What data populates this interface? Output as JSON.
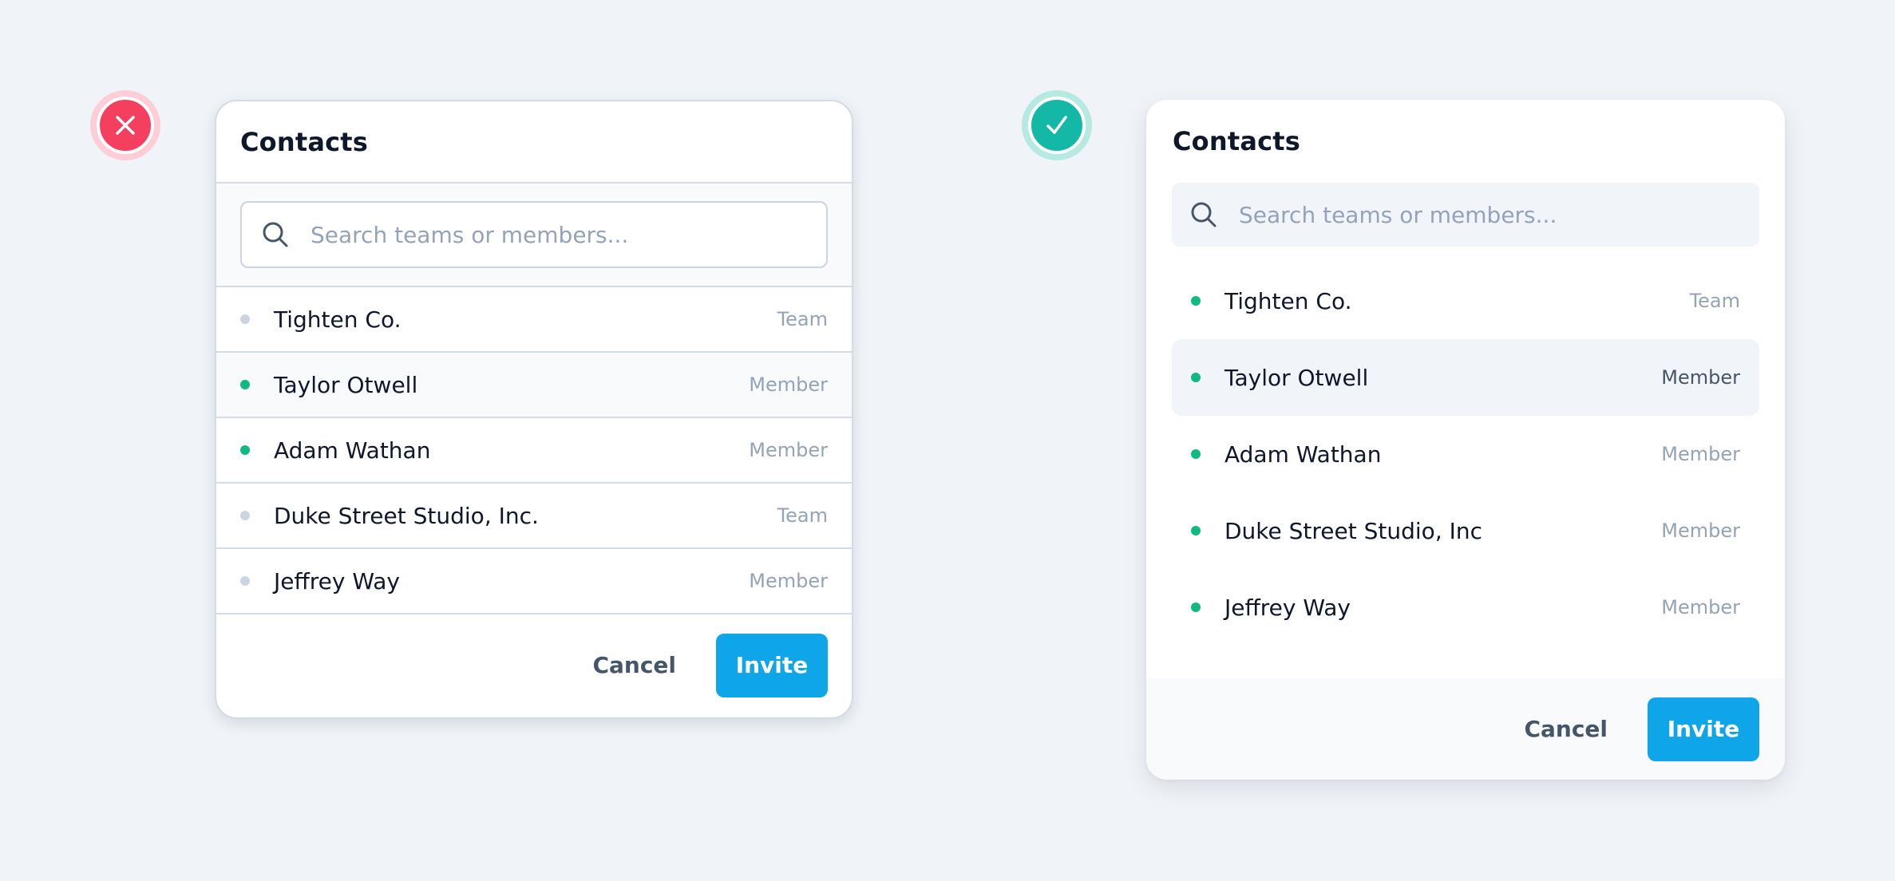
{
  "bad_example": {
    "status": "incorrect",
    "status_icon": "x-icon",
    "status_color": "#f43f5e",
    "title": "Contacts",
    "search": {
      "placeholder": "Search teams or members...",
      "value": ""
    },
    "items": [
      {
        "name": "Tighten Co.",
        "type": "Team",
        "online": false
      },
      {
        "name": "Taylor Otwell",
        "type": "Member",
        "online": true,
        "highlighted": true
      },
      {
        "name": "Adam Wathan",
        "type": "Member",
        "online": true
      },
      {
        "name": "Duke Street Studio, Inc.",
        "type": "Team",
        "online": false
      },
      {
        "name": "Jeffrey Way",
        "type": "Member",
        "online": false
      }
    ],
    "cancel_label": "Cancel",
    "invite_label": "Invite"
  },
  "good_example": {
    "status": "correct",
    "status_icon": "check-icon",
    "status_color": "#14b8a6",
    "title": "Contacts",
    "search": {
      "placeholder": "Search teams or members...",
      "value": ""
    },
    "items": [
      {
        "name": "Tighten Co.",
        "type": "Team",
        "online": true
      },
      {
        "name": "Taylor Otwell",
        "type": "Member",
        "online": true,
        "highlighted": true
      },
      {
        "name": "Adam Wathan",
        "type": "Member",
        "online": true
      },
      {
        "name": "Duke Street Studio, Inc",
        "type": "Member",
        "online": true
      },
      {
        "name": "Jeffrey Way",
        "type": "Member",
        "online": true
      }
    ],
    "cancel_label": "Cancel",
    "invite_label": "Invite"
  },
  "colors": {
    "background": "#f0f4f8",
    "accent": "#0ea5e9",
    "online": "#10b981",
    "offline": "#cbd5e1",
    "border": "#d3dbe5"
  }
}
